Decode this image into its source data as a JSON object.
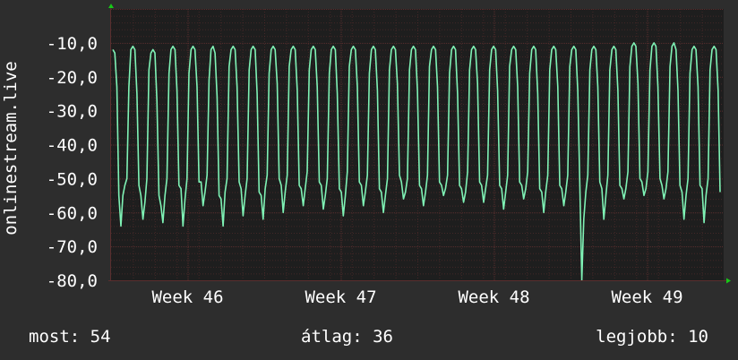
{
  "colors": {
    "background": "#2d2d2d",
    "plot_background": "#1e1e1e",
    "line": "#7ff2b5",
    "grid": "#5a2e2e",
    "text": "#ffffff",
    "arrow": "#18c818"
  },
  "chart_data": {
    "type": "line",
    "ylabel": "onlinestream.live",
    "ylim": [
      -80,
      0
    ],
    "yticks": [
      -10,
      -20,
      -30,
      -40,
      -50,
      -60,
      -70,
      -80
    ],
    "ytick_labels": [
      "-10,0",
      "-20,0",
      "-30,0",
      "-40,0",
      "-50,0",
      "-60,0",
      "-70,0",
      "-80,0"
    ],
    "xlim": [
      0,
      28
    ],
    "xticks": [
      3.5,
      10.5,
      17.5,
      24.5
    ],
    "xtick_labels": [
      "Week 46",
      "Week 47",
      "Week 48",
      "Week 49"
    ],
    "grid": true,
    "series": [
      {
        "values": [
          -12,
          -13,
          -23,
          -55,
          -64,
          -55,
          -52,
          -50,
          -23,
          -12,
          -11,
          -12,
          -25,
          -52,
          -55,
          -62,
          -57,
          -50,
          -18,
          -13,
          -12,
          -13,
          -27,
          -55,
          -58,
          -63,
          -55,
          -50,
          -19,
          -12,
          -11,
          -12,
          -24,
          -52,
          -53,
          -64,
          -56,
          -50,
          -19,
          -12,
          -11,
          -12,
          -23,
          -51,
          -51,
          -58,
          -54,
          -49,
          -21,
          -12,
          -11,
          -13,
          -26,
          -55,
          -56,
          -64,
          -54,
          -50,
          -17,
          -12,
          -11,
          -12,
          -23,
          -51,
          -53,
          -61,
          -55,
          -50,
          -18,
          -12,
          -11,
          -12,
          -25,
          -54,
          -55,
          -62,
          -53,
          -49,
          -19,
          -12,
          -11,
          -12,
          -22,
          -50,
          -52,
          -60,
          -54,
          -49,
          -17,
          -12,
          -11,
          -12,
          -24,
          -52,
          -53,
          -58,
          -53,
          -48,
          -18,
          -12,
          -11,
          -12,
          -23,
          -51,
          -52,
          -59,
          -55,
          -50,
          -19,
          -12,
          -11,
          -12,
          -25,
          -53,
          -54,
          -61,
          -55,
          -48,
          -17,
          -12,
          -11,
          -12,
          -23,
          -51,
          -52,
          -58,
          -54,
          -49,
          -19,
          -12,
          -11,
          -12,
          -24,
          -53,
          -54,
          -60,
          -55,
          -50,
          -18,
          -12,
          -11,
          -12,
          -22,
          -49,
          -51,
          -56,
          -54,
          -50,
          -18,
          -12,
          -11,
          -12,
          -24,
          -52,
          -53,
          -58,
          -54,
          -49,
          -17,
          -12,
          -11,
          -12,
          -23,
          -51,
          -52,
          -55,
          -53,
          -49,
          -19,
          -12,
          -11,
          -12,
          -25,
          -52,
          -53,
          -57,
          -54,
          -48,
          -18,
          -12,
          -11,
          -12,
          -22,
          -51,
          -52,
          -57,
          -53,
          -49,
          -18,
          -12,
          -11,
          -12,
          -24,
          -52,
          -53,
          -59,
          -54,
          -49,
          -17,
          -12,
          -11,
          -12,
          -23,
          -51,
          -52,
          -56,
          -53,
          -48,
          -19,
          -12,
          -11,
          -12,
          -25,
          -53,
          -54,
          -60,
          -54,
          -49,
          -18,
          -12,
          -11,
          -12,
          -23,
          -52,
          -53,
          -58,
          -54,
          -49,
          -17,
          -12,
          -11,
          -12,
          -24,
          -52,
          -80,
          -62,
          -54,
          -49,
          -18,
          -12,
          -11,
          -12,
          -23,
          -51,
          -53,
          -62,
          -55,
          -49,
          -18,
          -12,
          -11,
          -12,
          -24,
          -52,
          -53,
          -56,
          -53,
          -48,
          -17,
          -11,
          -10,
          -11,
          -22,
          -50,
          -51,
          -55,
          -53,
          -48,
          -18,
          -11,
          -10,
          -11,
          -23,
          -50,
          -52,
          -56,
          -53,
          -48,
          -17,
          -11,
          -10,
          -12,
          -24,
          -52,
          -54,
          -62,
          -55,
          -50,
          -19,
          -12,
          -11,
          -12,
          -23,
          -52,
          -53,
          -63,
          -55,
          -50,
          -18,
          -12,
          -11,
          -12,
          -24,
          -54
        ]
      }
    ]
  },
  "legend": {
    "most": "most: 54",
    "atlag": "átlag: 36",
    "legjobb": "legjobb: 10"
  }
}
